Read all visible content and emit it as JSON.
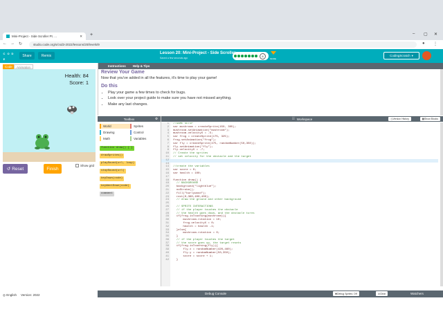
{
  "browser": {
    "tab_title": "Mini-Project - Side Scroller Pt. ...",
    "new_tab": "+",
    "url": "studio.code.org/s/csd3-2022/lessons/20/levels/9"
  },
  "header": {
    "logo_letters": [
      "C",
      "O",
      "D",
      "E",
      "",
      ""
    ],
    "share_label": "Share",
    "remix_label": "Remix",
    "lesson_title": "Lesson 20: Mini-Project - Side Scroller",
    "saved_text": "Saved a few seconds ago",
    "stage_number": "8",
    "more_label": "MORE",
    "user_label": "CodingScratch",
    "progress_dots": 7
  },
  "left": {
    "code_tab": "Code",
    "animation_tab": "Animation",
    "health_label": "Health: 84",
    "score_label": "Score:  1",
    "reset_label": "Reset",
    "finish_label": "Finish",
    "show_grid_label": "Show grid",
    "language": "English",
    "version": "Version: 2022"
  },
  "instructions": {
    "tab_instructions": "Instructions",
    "tab_help": "Help & Tips",
    "heading": "Review Your Game",
    "paragraph": "Now that you've added in all the features, it's time to play your game!",
    "do_this": "Do this",
    "items": [
      "Play your game a few times to check for bugs.",
      "Look over your project guide to make sure you have not missed anything.",
      "Make any last changes."
    ]
  },
  "toolbox": {
    "title": "Toolbox",
    "categories": [
      {
        "label": "World",
        "color": "#ffa400",
        "selected": true
      },
      {
        "label": "Sprites",
        "color": "#e4776d"
      },
      {
        "label": "Drawing",
        "color": "#2cb5d6"
      },
      {
        "label": "Control",
        "color": "#6f9fd9"
      },
      {
        "label": "Math",
        "color": "#ffd15c"
      },
      {
        "label": "Variables",
        "color": "#a7d18f"
      }
    ],
    "blocks": [
      "function draw() { }",
      "drawSprites()",
      "playSound(url, loop)",
      "stopSound(url)",
      "keyDown(code)",
      "keyWentDown(code)",
      "comment"
    ]
  },
  "editor": {
    "title": "Workspace",
    "version_history": "Version History",
    "show_blocks": "Show Blocks",
    "lines": [
      "//GAME SETUP",
      "var mushroom = createSprite(450, 305);",
      "mushroom.setAnimation(\"mushroom\");",
      "mushroom.velocityX = -5;",
      "var frog = createSprite(175, 325);",
      "frog.setAnimation(\"frog\");",
      "var fly = createSprite(475, randomNumber(50,350));",
      "fly.setAnimation(\"fly\");",
      "fly.velocityX = -7;",
      "// Create the sprites",
      "// set velocity for the obstacle and the target",
      "",
      "",
      "//create the variables",
      "var score = 0;",
      "var health = 100;",
      "",
      "function draw() {",
      "  // BACKGROUND",
      "  background(\"lightblue\");",
      "  noStroke();",
      "  fill(\"burlywood\");",
      "  rect(0,360,400,400);",
      "  // draw the ground and other background",
      "",
      "  // SPRITE INTERACTIONS",
      "  // if the player touches the obstacle",
      "  // the health goes down, and the obstacle turns",
      "  if(frog.isTouching(mushroom)){",
      "      mushroom.rotation = 10;",
      "      frog.velocityX = 0;",
      "      health = health -1;",
      "  }else{",
      "      mushroom.rotation = 0;",
      "  }",
      "  // if the player touches the target",
      "  // the score goes up, the target resets",
      "  if(frog.isTouching(fly)){",
      "      fly.x = randomNumber(420,460);",
      "      fly.y = randomNumber(50,350);",
      "      score = score + 1;",
      "  }"
    ],
    "highlight_line": 12
  },
  "debug": {
    "console_label": "Debug Console",
    "debug_sprites": "Debug Sprites: Off",
    "clear": "Clear",
    "watchers": "Watchers"
  }
}
